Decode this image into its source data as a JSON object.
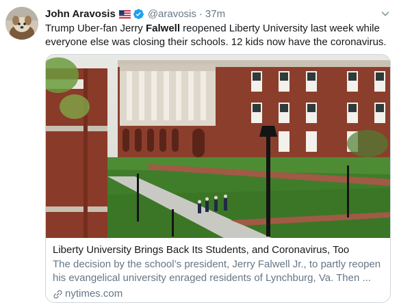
{
  "tweet": {
    "author_name": "John Aravosis",
    "handle": "@aravosis",
    "separator": "·",
    "time": "37m",
    "text_before": "Trump Uber-fan Jerry ",
    "text_bold": "Falwell",
    "text_after": " reopened Liberty University last week while everyone else was closing their schools. 12 kids now have the coronavirus."
  },
  "card": {
    "title": "Liberty University Brings Back Its Students, and Coronavirus, Too",
    "description": "The decision by the school’s president, Jerry Falwell Jr., to partly reopen his evangelical university enraged residents of Lynchburg, Va. Then ...",
    "domain": "nytimes.com"
  },
  "colors": {
    "verified": "#1da1f2",
    "secondary_text": "#657786",
    "border": "#ccd6dd"
  },
  "icons": [
    "us-flag-icon",
    "verified-badge-icon",
    "chevron-down-icon",
    "link-icon"
  ]
}
